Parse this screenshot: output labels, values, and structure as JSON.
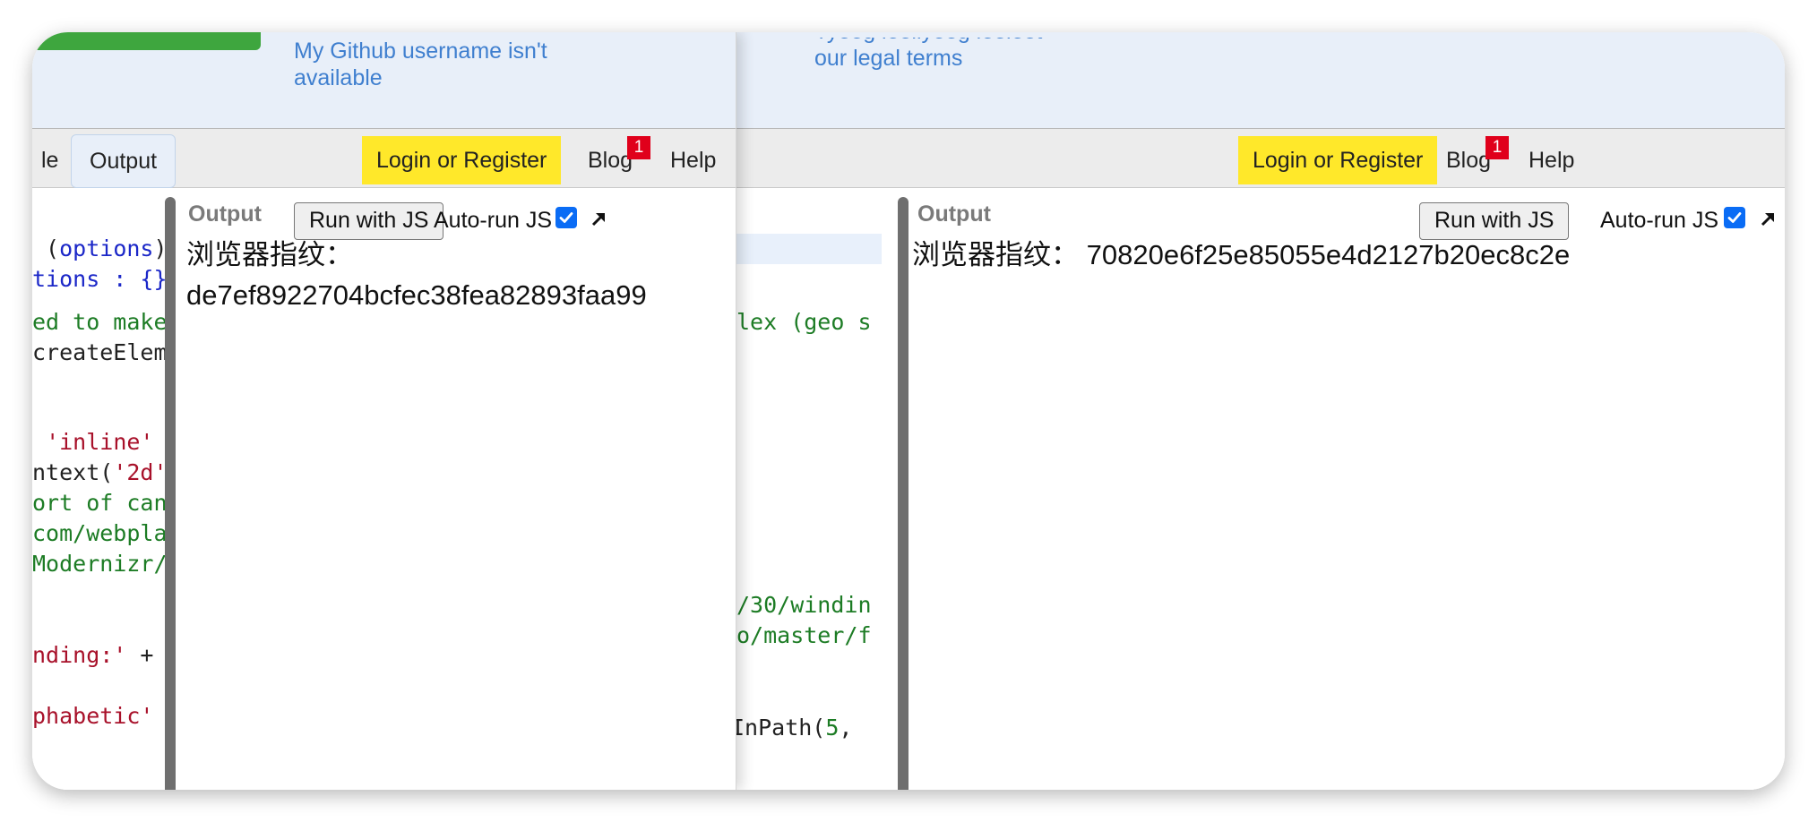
{
  "left_panel": {
    "banner": {
      "line1": "My Github username isn't",
      "line2": "available"
    },
    "toolbar": {
      "partial_tab": "le",
      "output_tab": "Output",
      "login": "Login or Register",
      "blog": "Blog",
      "blog_badge": "1",
      "help": "Help"
    },
    "code_lines": {
      "l1a": " (",
      "l1b": "options",
      "l1c": ")",
      "l2": "tions : {}",
      "l3": "ed to make",
      "l4": "createElem",
      "l5a": " ",
      "l5b": "'inline'",
      "l6a": "ntext(",
      "l6b": "'2d'",
      "l7": "ort of can",
      "l8": "com/webpla",
      "l9": "Modernizr/",
      "l10a": "nding:'",
      "l10b": " +",
      "l11": "phabetic'"
    },
    "output": {
      "title": "Output",
      "run_button": "Run with JS",
      "autorun_label": "Auto-run JS",
      "autorun_checked": true,
      "fingerprint_label": "浏览器指纹：",
      "fingerprint_value": "de7ef8922704bcfec38fea82893faa99"
    }
  },
  "right_panel": {
    "banner": {
      "line0": "Tyeeg leellyeeg leeleet",
      "line1": "our legal terms"
    },
    "toolbar": {
      "login": "Login or Register",
      "blog": "Blog",
      "blog_badge": "1",
      "help": "Help"
    },
    "code_lines": {
      "r1": "lex (geo s",
      "r2": "/30/windin",
      "r3": "o/master/f",
      "r4a": "InPath(",
      "r4b": "5",
      "r4c": ","
    },
    "output": {
      "title": "Output",
      "run_button": "Run with JS",
      "autorun_label": "Auto-run JS",
      "autorun_checked": true,
      "fingerprint_label": "浏览器指纹：",
      "fingerprint_value": "70820e6f25e85055e4d2127b20ec8c2e"
    }
  },
  "colors": {
    "banner_bg": "#e8eff9",
    "link_blue": "#3f7fcf",
    "login_yellow": "#ffe82a",
    "badge_red": "#e0001b",
    "checkbox_blue": "#0a6cf5",
    "code_string": "#a8112a",
    "code_variable": "#1b27c8",
    "code_comment": "#1d7c25"
  },
  "icons": {
    "popout": "arrow-up-right-icon",
    "checkbox": "checkmark-icon"
  }
}
